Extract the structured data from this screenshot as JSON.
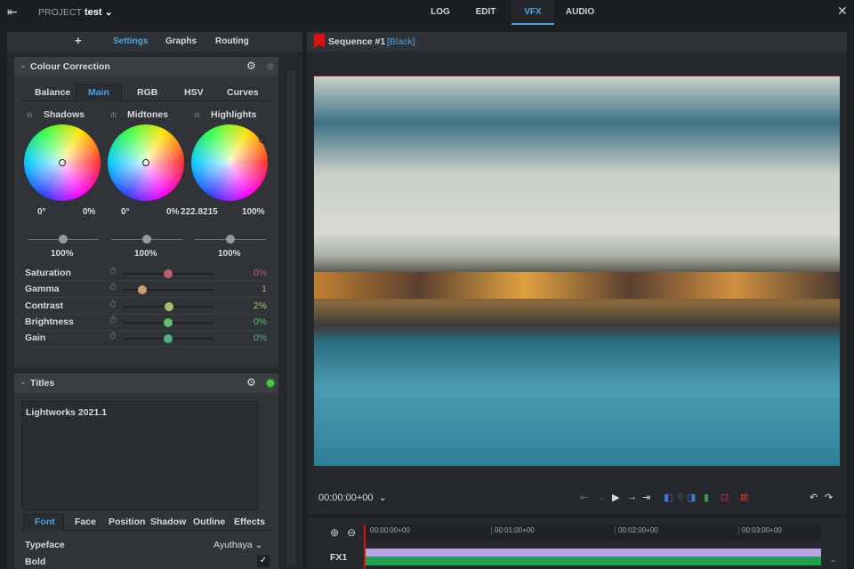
{
  "topbar": {
    "project_label": "PROJECT",
    "project_name": "test",
    "tabs": [
      "LOG",
      "EDIT",
      "VFX",
      "AUDIO"
    ],
    "active_tab": "VFX"
  },
  "left_panel": {
    "add": "+",
    "tabs": [
      "Settings",
      "Graphs",
      "Routing"
    ],
    "active": "Settings"
  },
  "colour_correction": {
    "title": "Colour Correction",
    "tabs": [
      "Balance",
      "Main",
      "RGB",
      "HSV",
      "Curves"
    ],
    "active": "Main",
    "wheels": [
      {
        "label": "Shadows",
        "angle": "0°",
        "amount": "0%",
        "level": "100%"
      },
      {
        "label": "Midtones",
        "angle": "0°",
        "amount": "0%",
        "level": "100%"
      },
      {
        "label": "Highlights",
        "angle": "222.8215",
        "amount": "100%",
        "level": "100%"
      }
    ],
    "params": [
      {
        "name": "Saturation",
        "value": "0%",
        "pos": 0.5,
        "color": "#c0606a"
      },
      {
        "name": "Gamma",
        "value": "1",
        "pos": 0.22,
        "color": "#c8a070"
      },
      {
        "name": "Contrast",
        "value": "2%",
        "pos": 0.51,
        "color": "#a8c060"
      },
      {
        "name": "Brightness",
        "value": "0%",
        "pos": 0.5,
        "color": "#60c070"
      },
      {
        "name": "Gain",
        "value": "0%",
        "pos": 0.5,
        "color": "#50b080"
      }
    ]
  },
  "titles": {
    "title": "Titles",
    "text": "Lightworks 2021.1",
    "tabs": [
      "Font",
      "Face",
      "Position",
      "Shadow",
      "Outline",
      "Effects"
    ],
    "active": "Font",
    "typeface_label": "Typeface",
    "typeface": "Ayuthaya",
    "bold_label": "Bold",
    "bold": true
  },
  "sequence": {
    "name": "Sequence #1",
    "tag": "[Black]"
  },
  "transport": {
    "timecode": "00:00:00+00"
  },
  "timeline": {
    "ticks": [
      "00:00:00+00",
      "00:01:00+00",
      "00:02:00+00",
      "00:03:00+00"
    ],
    "track": "FX1"
  }
}
